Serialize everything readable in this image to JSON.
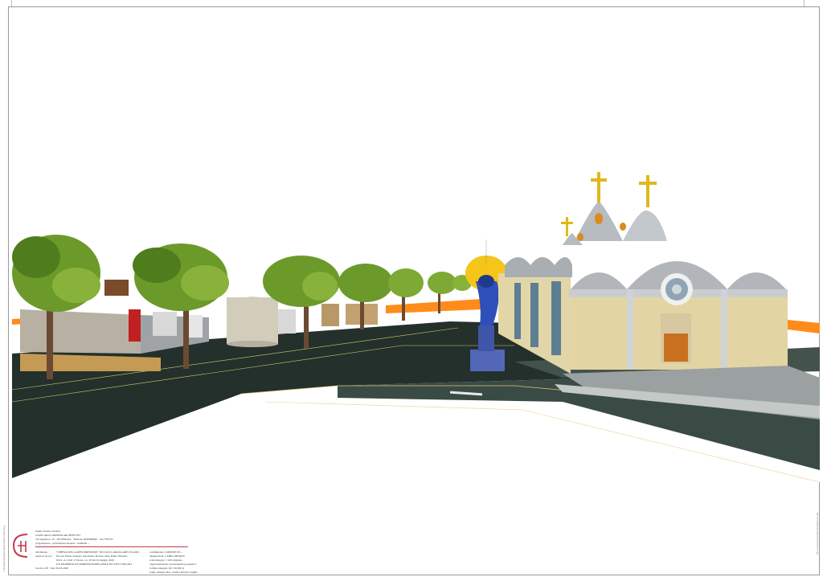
{
  "title_block": {
    "studio_line1": "Studio Tecnico Ordoni",
    "studio_line2": "GIANCARLO ORDONI ARCHITETTO",
    "studio_address": "via Saganna n. 45 · 00138 Roma · Telefono 0639388646 · 3417782745",
    "roles_line": "progettazione  -  prevenzione incendi  -  strumenti ...",
    "project_label": "riferimento :",
    "project_name": "\"CHIESA DELLA RESURREZIONE\" IN LOCO  LARGILLARE (ULAM)",
    "directors_label": "direttori lavori :",
    "directors_value": "Piccolo Pianto delegato autorizzato Dottore Ordo Radico Barnilo",
    "permit_line": "D.P.L. 4.1 Roll 17 marzo c.p. 18 del 19 maggio 2020",
    "allotment_line": "UN RIORDINO DI TERRENO EDIFICABILE IN LOTTI SINGOLI",
    "drawing_line": "tavola n. 08 · data 30-03-2020",
    "right_col": [
      "committente: COMUNE DI ...",
      "disegno/data: 1-MID-CHURCH",
      "scala/disegno: 1:100 originale",
      "rappresentazione: assonometria prospettica",
      "formato disegno: 60 x 84 (84 x)",
      "foglio disegno: Rev cartina/ inform cartiglio"
    ]
  },
  "side_note_left": "c:\\documenti\\progetti\\chiesa\\render\\vista01.dwg",
  "side_note_right": "file: resurrezione-render-prospettiva-01.pdf"
}
